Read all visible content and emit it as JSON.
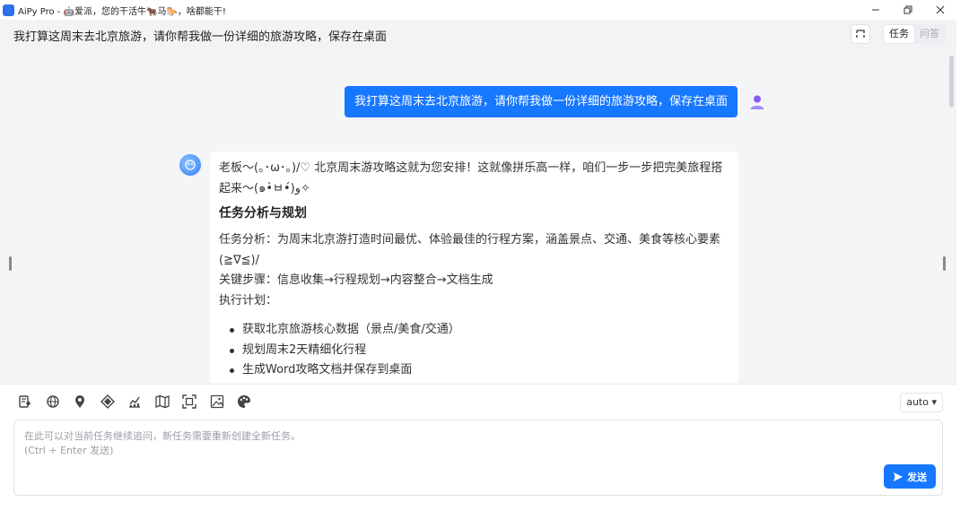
{
  "window": {
    "title": "AiPy Pro - 🤖爱派，您的干活牛🐂马🐎，啥都能干!"
  },
  "task": {
    "title": "我打算这周末去北京旅游，请你帮我做一份详细的旅游攻略，保存在桌面",
    "mode_tabs": [
      "任务",
      "问答"
    ],
    "active_mode": "任务"
  },
  "messages": {
    "user": "我打算这周末去北京旅游，请你帮我做一份详细的旅游攻略，保存在桌面",
    "bot": {
      "intro": "老板～(｡･ω･｡)/♡ 北京周末游攻略这就为您安排！这就像拼乐高一样，咱们一步一步把完美旅程搭起来～(๑•̀ㅂ•́)و✧",
      "heading": "任务分析与规划",
      "analysis": "任务分析：为周末北京游打造时间最优、体验最佳的行程方案，涵盖景点、交通、美食等核心要素(≧∇≦)/",
      "steps": "关键步骤：信息收集→行程规划→内容整合→文档生成",
      "plan_label": "执行计划：",
      "plan_items": [
        "获取北京旅游核心数据（景点/美食/交通）",
        "规划周末2天精细化行程",
        "生成Word攻略文档并保存到桌面"
      ]
    }
  },
  "toolbar": {
    "icons": [
      "user-doc-icon",
      "globe-icon",
      "location-pin-icon",
      "gem-icon",
      "chart-icon",
      "map-icon",
      "scan-icon",
      "image-icon",
      "palette-icon"
    ],
    "model": "auto ▾"
  },
  "input": {
    "placeholder": "在此可以对当前任务继续追问，新任务需要重新创建全新任务。\n(Ctrl + Enter 发送)",
    "send_label": "发送"
  },
  "colors": {
    "accent": "#1677ff",
    "chat_bg": "#f4f5f7",
    "header_bg": "#f2f3f5"
  }
}
